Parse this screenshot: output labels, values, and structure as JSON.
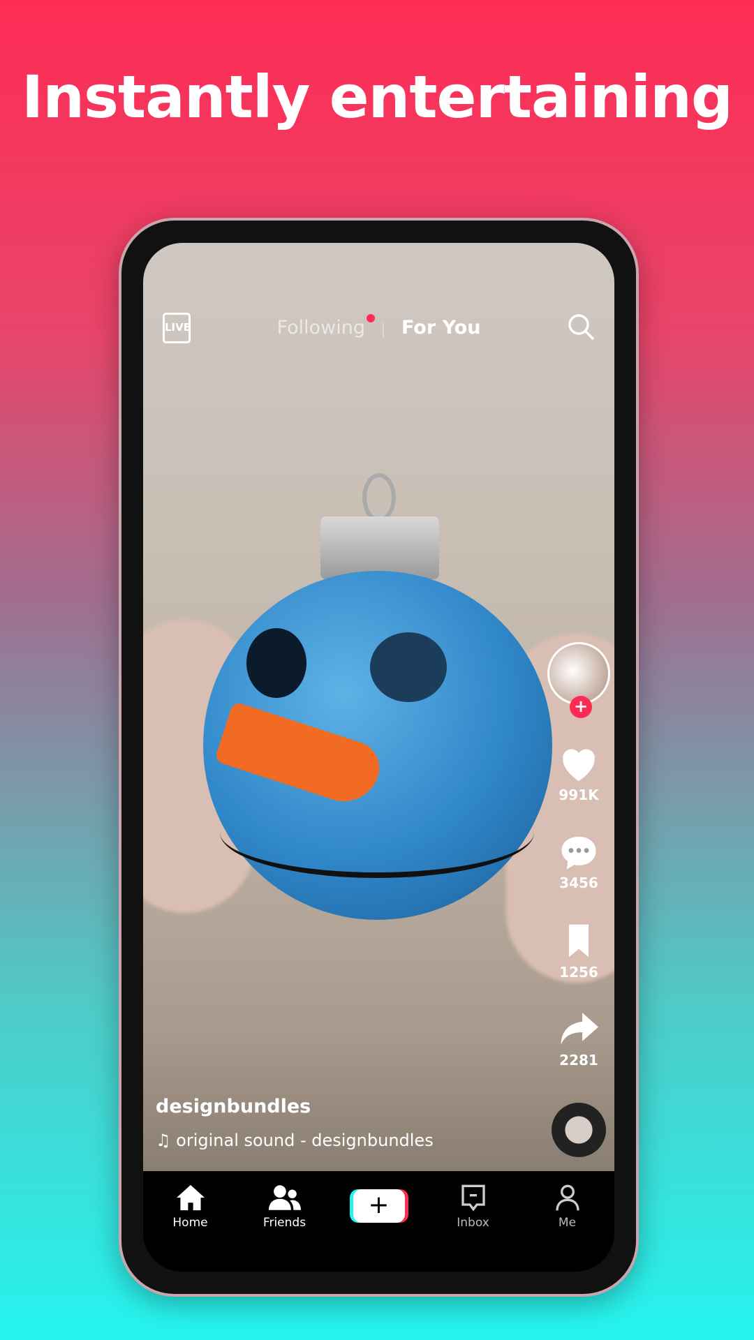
{
  "headline": "Instantly entertaining",
  "colors": {
    "accent_red": "#fe2c55",
    "accent_cyan": "#25f4ee"
  },
  "topbar": {
    "live_label": "LIVE",
    "tabs": [
      {
        "label": "Following",
        "active": false,
        "has_notification_dot": true
      },
      {
        "label": "For You",
        "active": true
      }
    ],
    "search_icon": "search-icon"
  },
  "rail": {
    "like_count": "991K",
    "comment_count": "3456",
    "bookmark_count": "1256",
    "share_count": "2281",
    "follow_icon": "plus-icon"
  },
  "video": {
    "username": "designbundles",
    "sound": "original sound - designbundles"
  },
  "nav": {
    "items": [
      {
        "label": "Home",
        "icon": "home-icon",
        "active": true
      },
      {
        "label": "Friends",
        "icon": "friends-icon",
        "active": true
      },
      {
        "label": "",
        "icon": "create-plus-icon"
      },
      {
        "label": "Inbox",
        "icon": "inbox-icon",
        "active": false
      },
      {
        "label": "Me",
        "icon": "profile-icon",
        "active": false
      }
    ]
  }
}
